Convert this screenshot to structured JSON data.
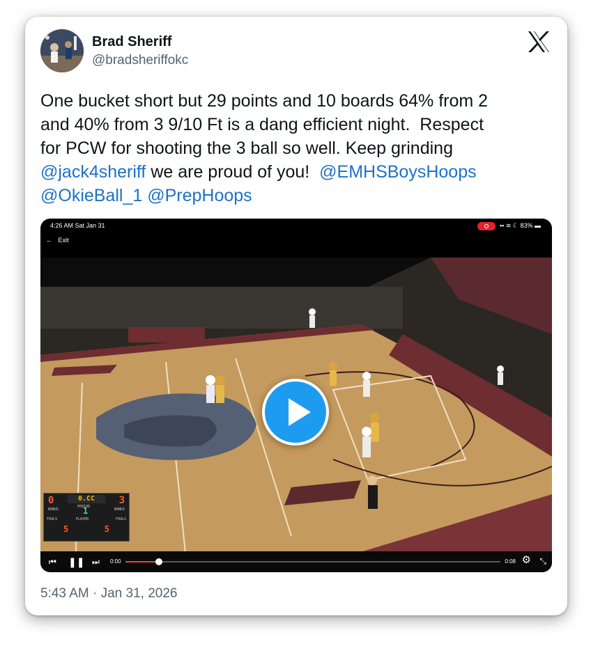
{
  "author": {
    "name": "Brad Sheriff",
    "handle": "@bradsheriffokc"
  },
  "tweet": {
    "text_1": "One bucket short but 29 points and 10 boards 64% from 2\nand 40% from 3 9/10 Ft is a dang efficient night.  Respect\nfor PCW for shooting the 3 ball so well. Keep grinding\n",
    "mention_1": "@jack4sheriff",
    "text_2": " we are proud of you!  ",
    "mention_2": "@EMHSBoysHoops",
    "text_3": "\n",
    "mention_3": "@OkieBall_1",
    "text_4": " ",
    "mention_4": "@PrepHoops"
  },
  "video": {
    "status_time": "4:26 AM  Sat Jan 31",
    "battery": "83%",
    "exit_label": "Exit",
    "scoreboard": {
      "home_score": "0",
      "clock": "0.CC",
      "away_score": "3",
      "period": "1",
      "home_fouls": "5",
      "away_fouls": "5",
      "labels": {
        "bonus": "BONUS",
        "period": "PERIOD",
        "fouls": "FOULS",
        "player": "PLAYER"
      }
    },
    "time_current": "0:00",
    "time_end": "0:08",
    "progress": 0.09
  },
  "timestamp": "5:43 AM · Jan 31, 2026",
  "colors": {
    "link": "#1d72c9",
    "play": "#1d9bf0",
    "court": "#c49a5e",
    "accent_progress": "#e94b2a"
  }
}
